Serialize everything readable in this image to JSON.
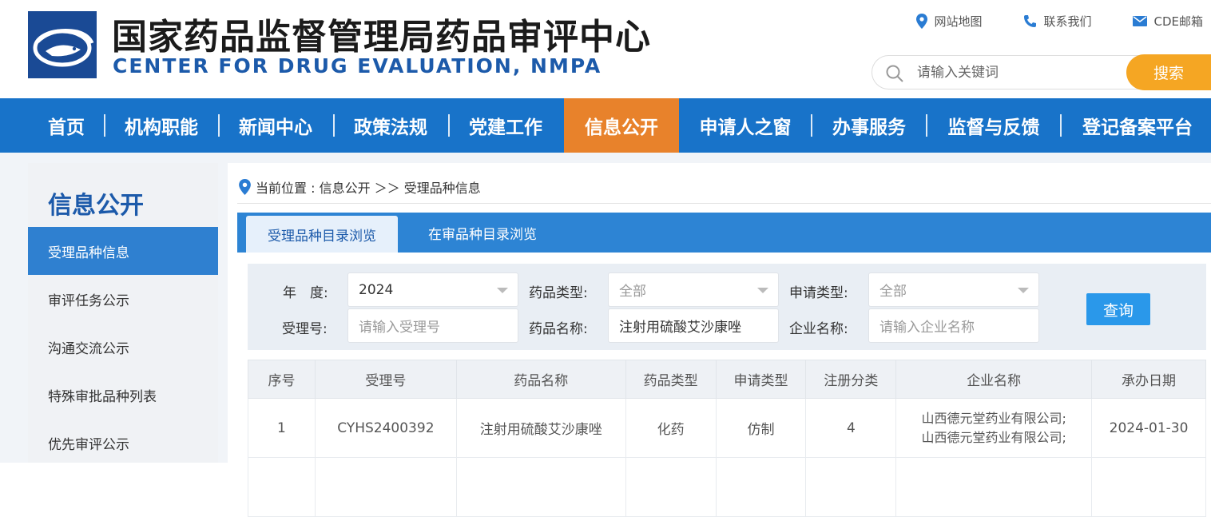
{
  "header": {
    "title_cn": "国家药品监督管理局药品审评中心",
    "title_en": "CENTER FOR DRUG EVALUATION, NMPA",
    "top_links": [
      {
        "label": "网站地图",
        "icon": "location-pin-icon"
      },
      {
        "label": "联系我们",
        "icon": "phone-icon"
      },
      {
        "label": "CDE邮箱",
        "icon": "mail-icon"
      }
    ],
    "search": {
      "placeholder": "请输入关键词",
      "button": "搜索"
    }
  },
  "nav": {
    "items": [
      "首页",
      "机构职能",
      "新闻中心",
      "政策法规",
      "党建工作",
      "信息公开",
      "申请人之窗",
      "办事服务",
      "监督与反馈",
      "登记备案平台"
    ],
    "active": "信息公开"
  },
  "sidebar": {
    "title": "信息公开",
    "items": [
      "受理品种信息",
      "审评任务公示",
      "沟通交流公示",
      "特殊审批品种列表",
      "优先审评公示"
    ],
    "active": "受理品种信息"
  },
  "breadcrumb": {
    "label": "当前位置 : 信息公开 ＞＞ 受理品种信息"
  },
  "tabs": [
    {
      "label": "受理品种目录浏览",
      "active": true
    },
    {
      "label": "在审品种目录浏览",
      "active": false
    }
  ],
  "filter": {
    "year_label": "年　度:",
    "year_value": "2024",
    "drug_type_label": "药品类型:",
    "drug_type_value": "全部",
    "apply_type_label": "申请类型:",
    "apply_type_value": "全部",
    "accept_no_label": "受理号:",
    "accept_no_placeholder": "请输入受理号",
    "drug_name_label": "药品名称:",
    "drug_name_value": "注射用硫酸艾沙康唑",
    "company_label": "企业名称:",
    "company_placeholder": "请输入企业名称",
    "query_button": "查询"
  },
  "table": {
    "headers": [
      "序号",
      "受理号",
      "药品名称",
      "药品类型",
      "申请类型",
      "注册分类",
      "企业名称",
      "承办日期"
    ],
    "rows": [
      {
        "index": "1",
        "accept_no": "CYHS2400392",
        "drug_name": "注射用硫酸艾沙康唑",
        "drug_type": "化药",
        "apply_type": "仿制",
        "reg_class": "4",
        "company_line1": "山西德元堂药业有限公司;",
        "company_line2": "山西德元堂药业有限公司;",
        "date": "2024-01-30"
      }
    ]
  },
  "colors": {
    "nav_blue": "#1873c9",
    "nav_active": "#e8822b",
    "search_button": "#f5a623",
    "title_blue": "#1c5aaa",
    "query_button": "#2a98ea"
  }
}
